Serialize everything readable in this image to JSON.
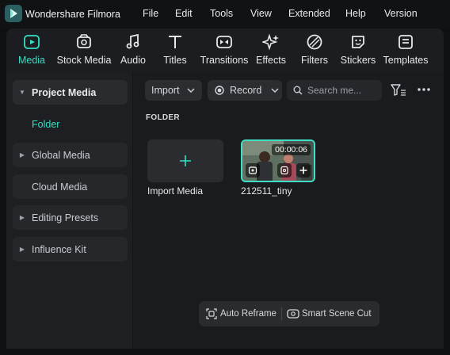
{
  "app": {
    "title": "Wondershare Filmora"
  },
  "menu": [
    "File",
    "Edit",
    "Tools",
    "View",
    "Extended",
    "Help",
    "Version"
  ],
  "tabs": [
    {
      "label": "Media",
      "icon": "media-icon",
      "active": true
    },
    {
      "label": "Stock Media",
      "icon": "stock-media-icon",
      "active": false
    },
    {
      "label": "Audio",
      "icon": "music-note-icon",
      "active": false
    },
    {
      "label": "Titles",
      "icon": "text-t-icon",
      "active": false
    },
    {
      "label": "Transitions",
      "icon": "transitions-icon",
      "active": false
    },
    {
      "label": "Effects",
      "icon": "sparkle-effects-icon",
      "active": false
    },
    {
      "label": "Filters",
      "icon": "filters-icon",
      "active": false
    },
    {
      "label": "Stickers",
      "icon": "sticker-icon",
      "active": false
    },
    {
      "label": "Templates",
      "icon": "templates-icon",
      "active": false
    }
  ],
  "sidebar": {
    "items": [
      {
        "label": "Project Media",
        "expanded": true
      },
      {
        "label": "Global Media",
        "expanded": false
      },
      {
        "label": "Cloud Media",
        "expanded": false
      },
      {
        "label": "Editing Presets",
        "expanded": false
      },
      {
        "label": "Influence Kit",
        "expanded": false
      }
    ],
    "folder": "Folder"
  },
  "toolbar": {
    "import_label": "Import",
    "record_label": "Record",
    "search_placeholder": "Search me..."
  },
  "content": {
    "section_label": "FOLDER",
    "import_tile_label": "Import Media",
    "clip": {
      "name": "212511_tiny",
      "duration": "00:00:06"
    }
  },
  "bottom_bar": {
    "auto_reframe": "Auto Reframe",
    "smart_scene_cut": "Smart Scene Cut"
  },
  "colors": {
    "accent": "#34e0c4",
    "background": "#1a1b1e"
  }
}
